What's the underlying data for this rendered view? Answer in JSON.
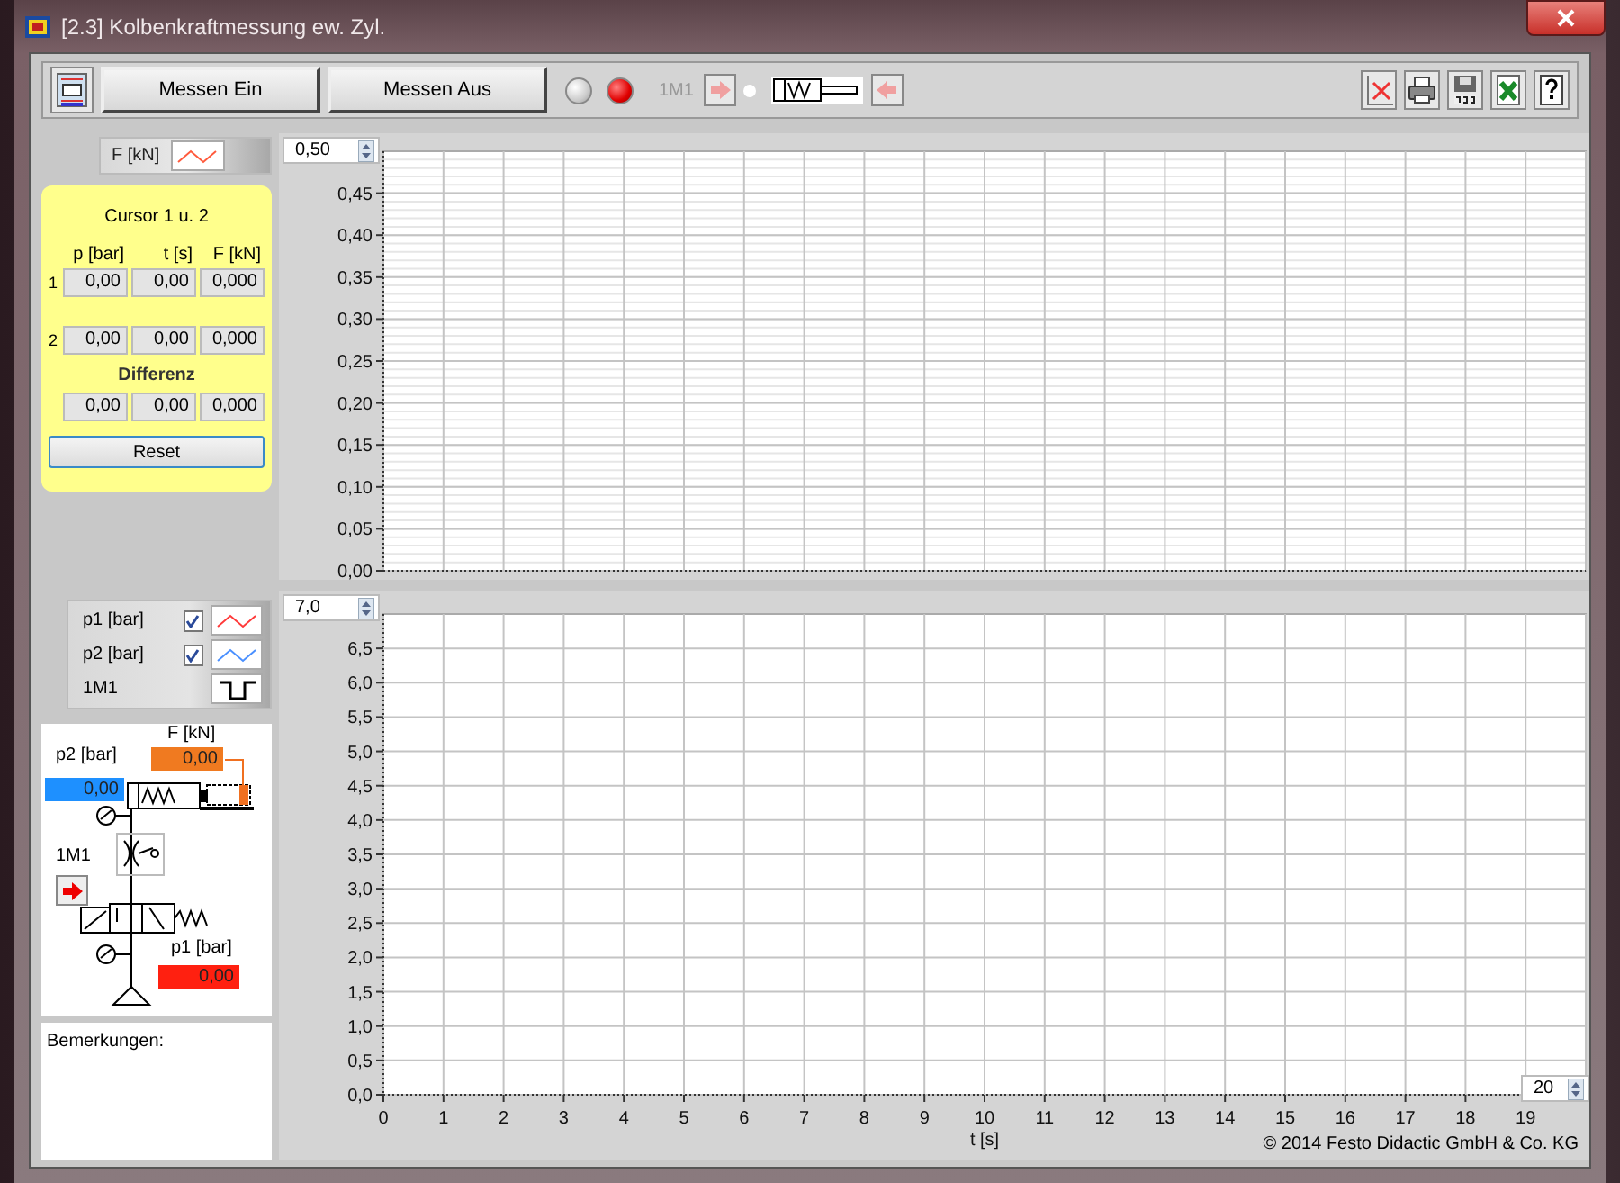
{
  "window": {
    "title": "[2.3] Kolbenkraftmessung ew. Zyl."
  },
  "toolbar": {
    "buttons": [
      {
        "label": "Messen Ein"
      },
      {
        "label": "Messen Aus"
      }
    ],
    "lamps": [
      {
        "on": false
      },
      {
        "on": true
      }
    ],
    "valve_label": "1M1",
    "valve_lamp_on": false
  },
  "legend_top": [
    {
      "label": "F [kN]",
      "color": "#ff5a3c"
    }
  ],
  "cursor_panel": {
    "title": "Cursor 1 u. 2",
    "columns": [
      "p [bar]",
      "t [s]",
      "F [kN]"
    ],
    "rows": [
      {
        "label": "1",
        "values": [
          "0,00",
          "0,00",
          "0,000"
        ]
      },
      {
        "label": "2",
        "values": [
          "0,00",
          "0,00",
          "0,000"
        ]
      }
    ],
    "difference_title": "Differenz",
    "difference": [
      "0,00",
      "0,00",
      "0,000"
    ],
    "reset": "Reset"
  },
  "legend_bottom": [
    {
      "label": "p1 [bar]",
      "checked": true,
      "kind": "line",
      "color": "#ff3a3a"
    },
    {
      "label": "p2 [bar]",
      "checked": true,
      "kind": "line",
      "color": "#4a90ff"
    },
    {
      "label": "1M1",
      "kind": "pulse"
    }
  ],
  "schematic": {
    "p2_label": "p2 [bar]",
    "p2_value": "0,00",
    "force_label": "F [kN]",
    "force_value": "0,00",
    "valve_label": "1M1",
    "p1_label": "p1 [bar]",
    "p1_value": "0,00"
  },
  "remarks": {
    "label": "Bemerkungen:"
  },
  "charts": [
    {
      "max": "0,50",
      "chart_data": {
        "type": "line",
        "grid": true,
        "xlim": [
          0,
          20
        ],
        "ylim": [
          0,
          0.5
        ],
        "yticks": [
          {
            "value": 0,
            "label": "0,00"
          },
          {
            "value": 0.05,
            "label": "0,05"
          },
          {
            "value": 0.1,
            "label": "0,10"
          },
          {
            "value": 0.15,
            "label": "0,15"
          },
          {
            "value": 0.2,
            "label": "0,20"
          },
          {
            "value": 0.25,
            "label": "0,25"
          },
          {
            "value": 0.3,
            "label": "0,30"
          },
          {
            "value": 0.35,
            "label": "0,35"
          },
          {
            "value": 0.4,
            "label": "0,40"
          },
          {
            "value": 0.45,
            "label": "0,45"
          }
        ]
      }
    },
    {
      "max": "7,0",
      "x_max": "20",
      "chart_data": {
        "type": "line",
        "grid": true,
        "xlabel": "t [s]",
        "xlim": [
          0,
          20
        ],
        "ylim": [
          0,
          7
        ],
        "xticks": [
          0,
          1,
          2,
          3,
          4,
          5,
          6,
          7,
          8,
          9,
          10,
          11,
          12,
          13,
          14,
          15,
          16,
          17,
          18,
          19
        ],
        "yticks": [
          {
            "value": 0,
            "label": "0,0"
          },
          {
            "value": 0.5,
            "label": "0,5"
          },
          {
            "value": 1,
            "label": "1,0"
          },
          {
            "value": 1.5,
            "label": "1,5"
          },
          {
            "value": 2,
            "label": "2,0"
          },
          {
            "value": 2.5,
            "label": "2,5"
          },
          {
            "value": 3,
            "label": "3,0"
          },
          {
            "value": 3.5,
            "label": "3,5"
          },
          {
            "value": 4,
            "label": "4,0"
          },
          {
            "value": 4.5,
            "label": "4,5"
          },
          {
            "value": 5,
            "label": "5,0"
          },
          {
            "value": 5.5,
            "label": "5,5"
          },
          {
            "value": 6,
            "label": "6,0"
          },
          {
            "value": 6.5,
            "label": "6,5"
          }
        ]
      }
    }
  ],
  "copyright": "©  2014 Festo Didactic GmbH & Co. KG"
}
